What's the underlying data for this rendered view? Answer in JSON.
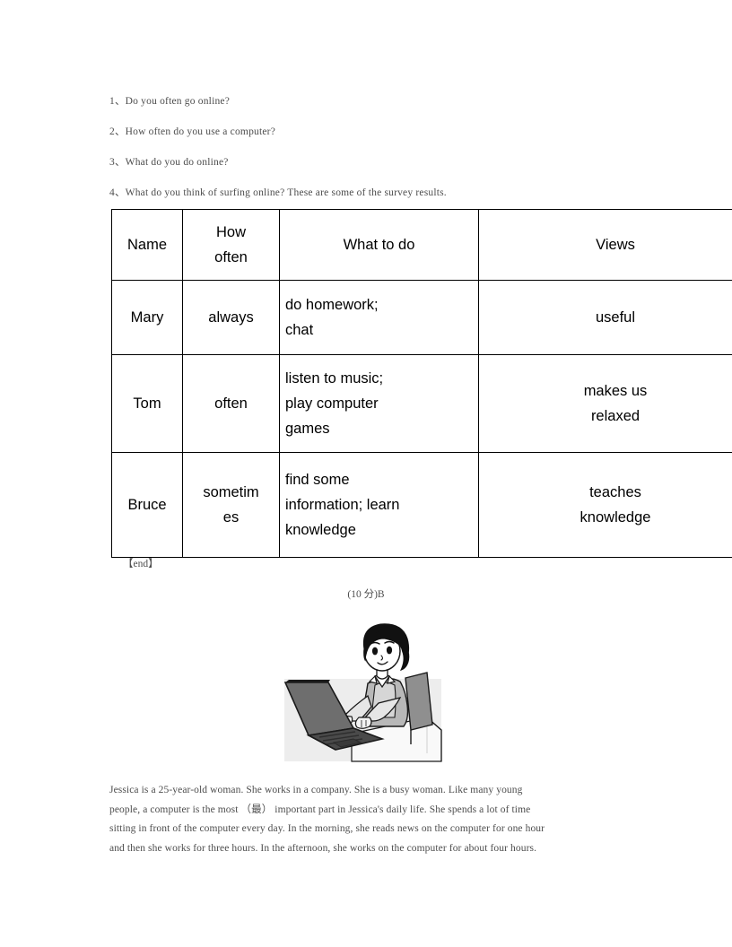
{
  "document": {
    "questions": [
      "1、Do you often go online?",
      "2、How often do you use a computer?",
      "3、What do you do online?",
      "4、What do you think of surfing online? These are some of the survey results."
    ],
    "table": {
      "headers": [
        "Name",
        "How often",
        "What to do",
        "Views"
      ],
      "header_how_line1": "How",
      "header_how_line2": "often",
      "rows": [
        {
          "name": "Mary",
          "how_often": "always",
          "what_to_do_line1": "do homework;",
          "what_to_do_line2": "chat",
          "what_to_do_line3": "",
          "views_line1": "useful",
          "views_line2": ""
        },
        {
          "name": "Tom",
          "how_often": "often",
          "what_to_do_line1": "listen to music;",
          "what_to_do_line2": "play computer",
          "what_to_do_line3": "games",
          "views_line1": "makes us",
          "views_line2": "relaxed"
        },
        {
          "name": "Bruce",
          "how_often_line1": "sometim",
          "how_often_line2": "es",
          "what_to_do_line1": "find some",
          "what_to_do_line2": "information; learn",
          "what_to_do_line3": "knowledge",
          "views_line1": "teaches",
          "views_line2": "knowledge"
        }
      ]
    },
    "end_marker": "【end】",
    "score_line": "(10 分)B",
    "passage_lines": [
      "Jessica is a 25-year-old woman. She works in a company. She is a busy woman. Like many young",
      "people, a computer is the most （最） important part in Jessica's daily life. She spends a lot of time",
      "sitting in front of the computer every day. In the morning, she reads news on the computer for one hour",
      "and then she works for three hours. In the afternoon, she works on the computer for about four hours."
    ],
    "illustration": {
      "alt": "cartoon woman typing on a laptop at a desk",
      "colors": {
        "background_panel": "#ededed",
        "outline": "#1a1a1a",
        "hair": "#111111",
        "skin": "#ffffff",
        "vest": "#b3b3b3",
        "laptop_lid": "#6e6e6e",
        "laptop_base": "#4a4a4a",
        "chair": "#8c8c8c",
        "desk": "#f7f7f7"
      }
    },
    "text_colors": {
      "body_text": "#4d4d4d",
      "table_text": "#000000",
      "table_border": "#000000"
    }
  }
}
